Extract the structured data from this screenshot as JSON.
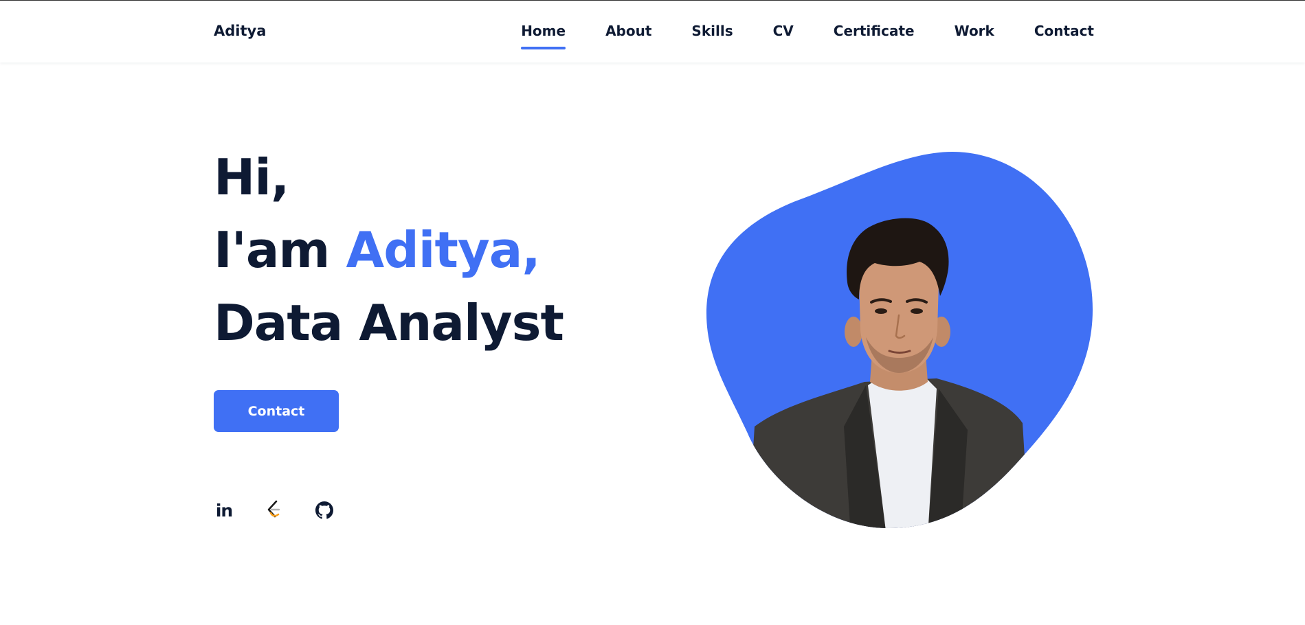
{
  "header": {
    "logo": "Aditya",
    "nav": [
      {
        "label": "Home",
        "active": true
      },
      {
        "label": "About",
        "active": false
      },
      {
        "label": "Skills",
        "active": false
      },
      {
        "label": "CV",
        "active": false
      },
      {
        "label": "Certificate",
        "active": false
      },
      {
        "label": "Work",
        "active": false
      },
      {
        "label": "Contact",
        "active": false
      }
    ]
  },
  "hero": {
    "greeting": "Hi,",
    "intro_prefix": "I'am ",
    "name": "Aditya,",
    "role": "Data Analyst",
    "button_label": "Contact"
  },
  "socials": [
    {
      "icon": "linkedin-icon",
      "label": "in"
    },
    {
      "icon": "leetcode-icon"
    },
    {
      "icon": "github-icon"
    }
  ],
  "colors": {
    "accent": "#4070f4",
    "text": "#0e1a33",
    "background": "#ffffff"
  }
}
